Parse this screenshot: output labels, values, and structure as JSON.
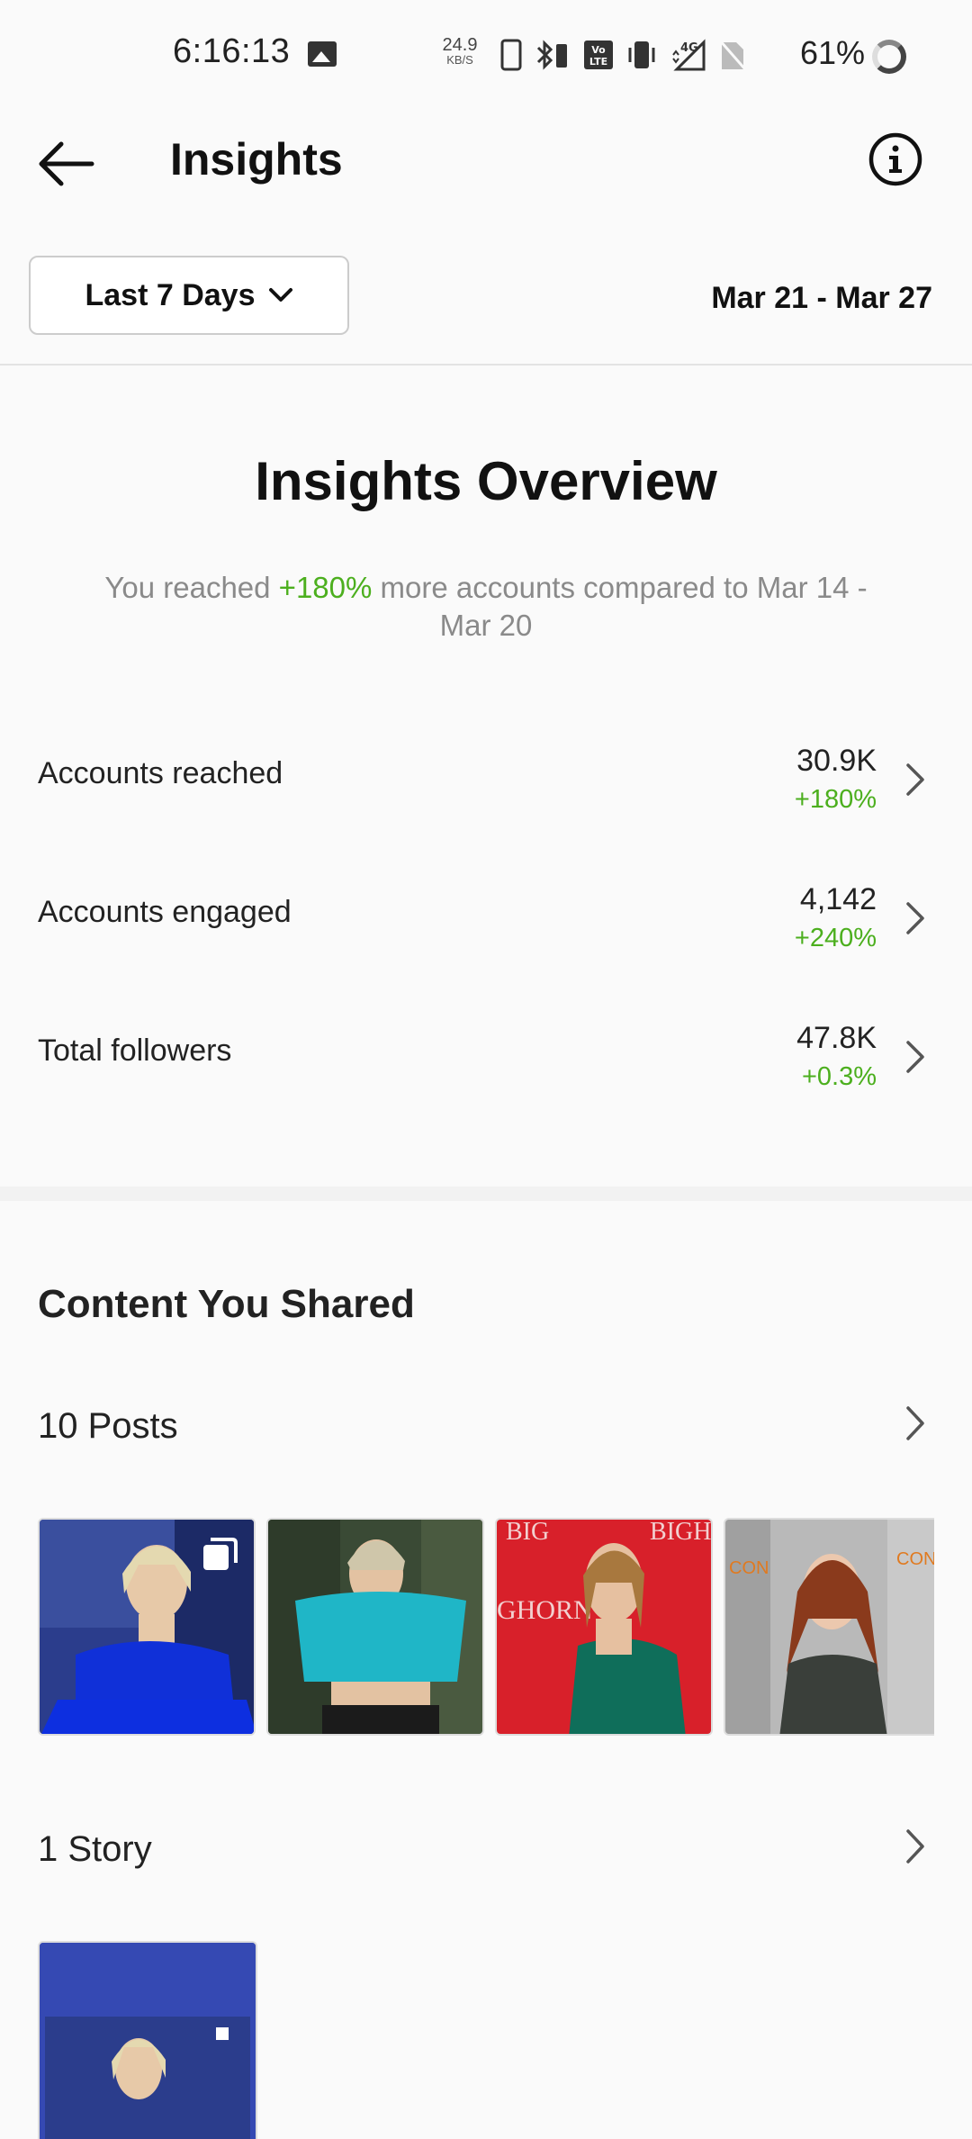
{
  "status_bar": {
    "time": "6:16:13",
    "net_speed_value": "24.9",
    "net_speed_unit": "KB/S",
    "battery_percent": "61%",
    "icons": [
      "image-notification-icon",
      "phone-icon",
      "bluetooth-battery-icon",
      "volte-icon",
      "vibrate-icon",
      "signal-4g-icon",
      "no-sim-icon",
      "battery-ring-icon"
    ]
  },
  "app_bar": {
    "title": "Insights"
  },
  "filter": {
    "range_label": "Last 7 Days",
    "date_range": "Mar 21 - Mar 27"
  },
  "overview": {
    "title": "Insights Overview",
    "sub_prefix": "You reached ",
    "sub_highlight": "+180%",
    "sub_suffix": " more accounts compared to Mar 14 - Mar 20",
    "metrics": [
      {
        "name": "Accounts reached",
        "value": "30.9K",
        "change": "+180%"
      },
      {
        "name": "Accounts engaged",
        "value": "4,142",
        "change": "+240%"
      },
      {
        "name": "Total followers",
        "value": "47.8K",
        "change": "+0.3%"
      }
    ]
  },
  "content": {
    "title": "Content You Shared",
    "posts_label": "10 Posts",
    "story_label": "1 Story"
  },
  "colors": {
    "positive": "#4caf1e",
    "muted_text": "#8a8a8a"
  }
}
